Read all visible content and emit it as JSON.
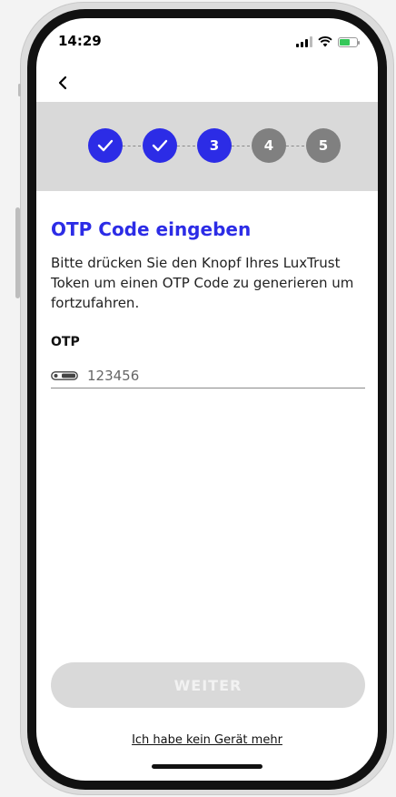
{
  "status_bar": {
    "time": "14:29"
  },
  "stepper": {
    "steps": [
      {
        "label": "",
        "state": "done"
      },
      {
        "label": "",
        "state": "done"
      },
      {
        "label": "3",
        "state": "current"
      },
      {
        "label": "4",
        "state": "todo"
      },
      {
        "label": "5",
        "state": "todo"
      }
    ]
  },
  "main": {
    "title": "OTP Code eingeben",
    "description": "Bitte drücken Sie den Knopf Ihres LuxTrust Token um einen OTP Code zu generieren um fortzufahren.",
    "otp_label": "OTP",
    "otp_placeholder": "123456"
  },
  "footer": {
    "submit_label": "WEITER",
    "no_device_link": "Ich habe kein Gerät mehr"
  },
  "colors": {
    "accent": "#2c2ce6",
    "step_inactive": "#808080",
    "band": "#d9d9d9"
  },
  "icons": [
    "chevron-left-icon",
    "signal-icon",
    "wifi-icon",
    "battery-icon",
    "check-icon",
    "token-icon"
  ]
}
